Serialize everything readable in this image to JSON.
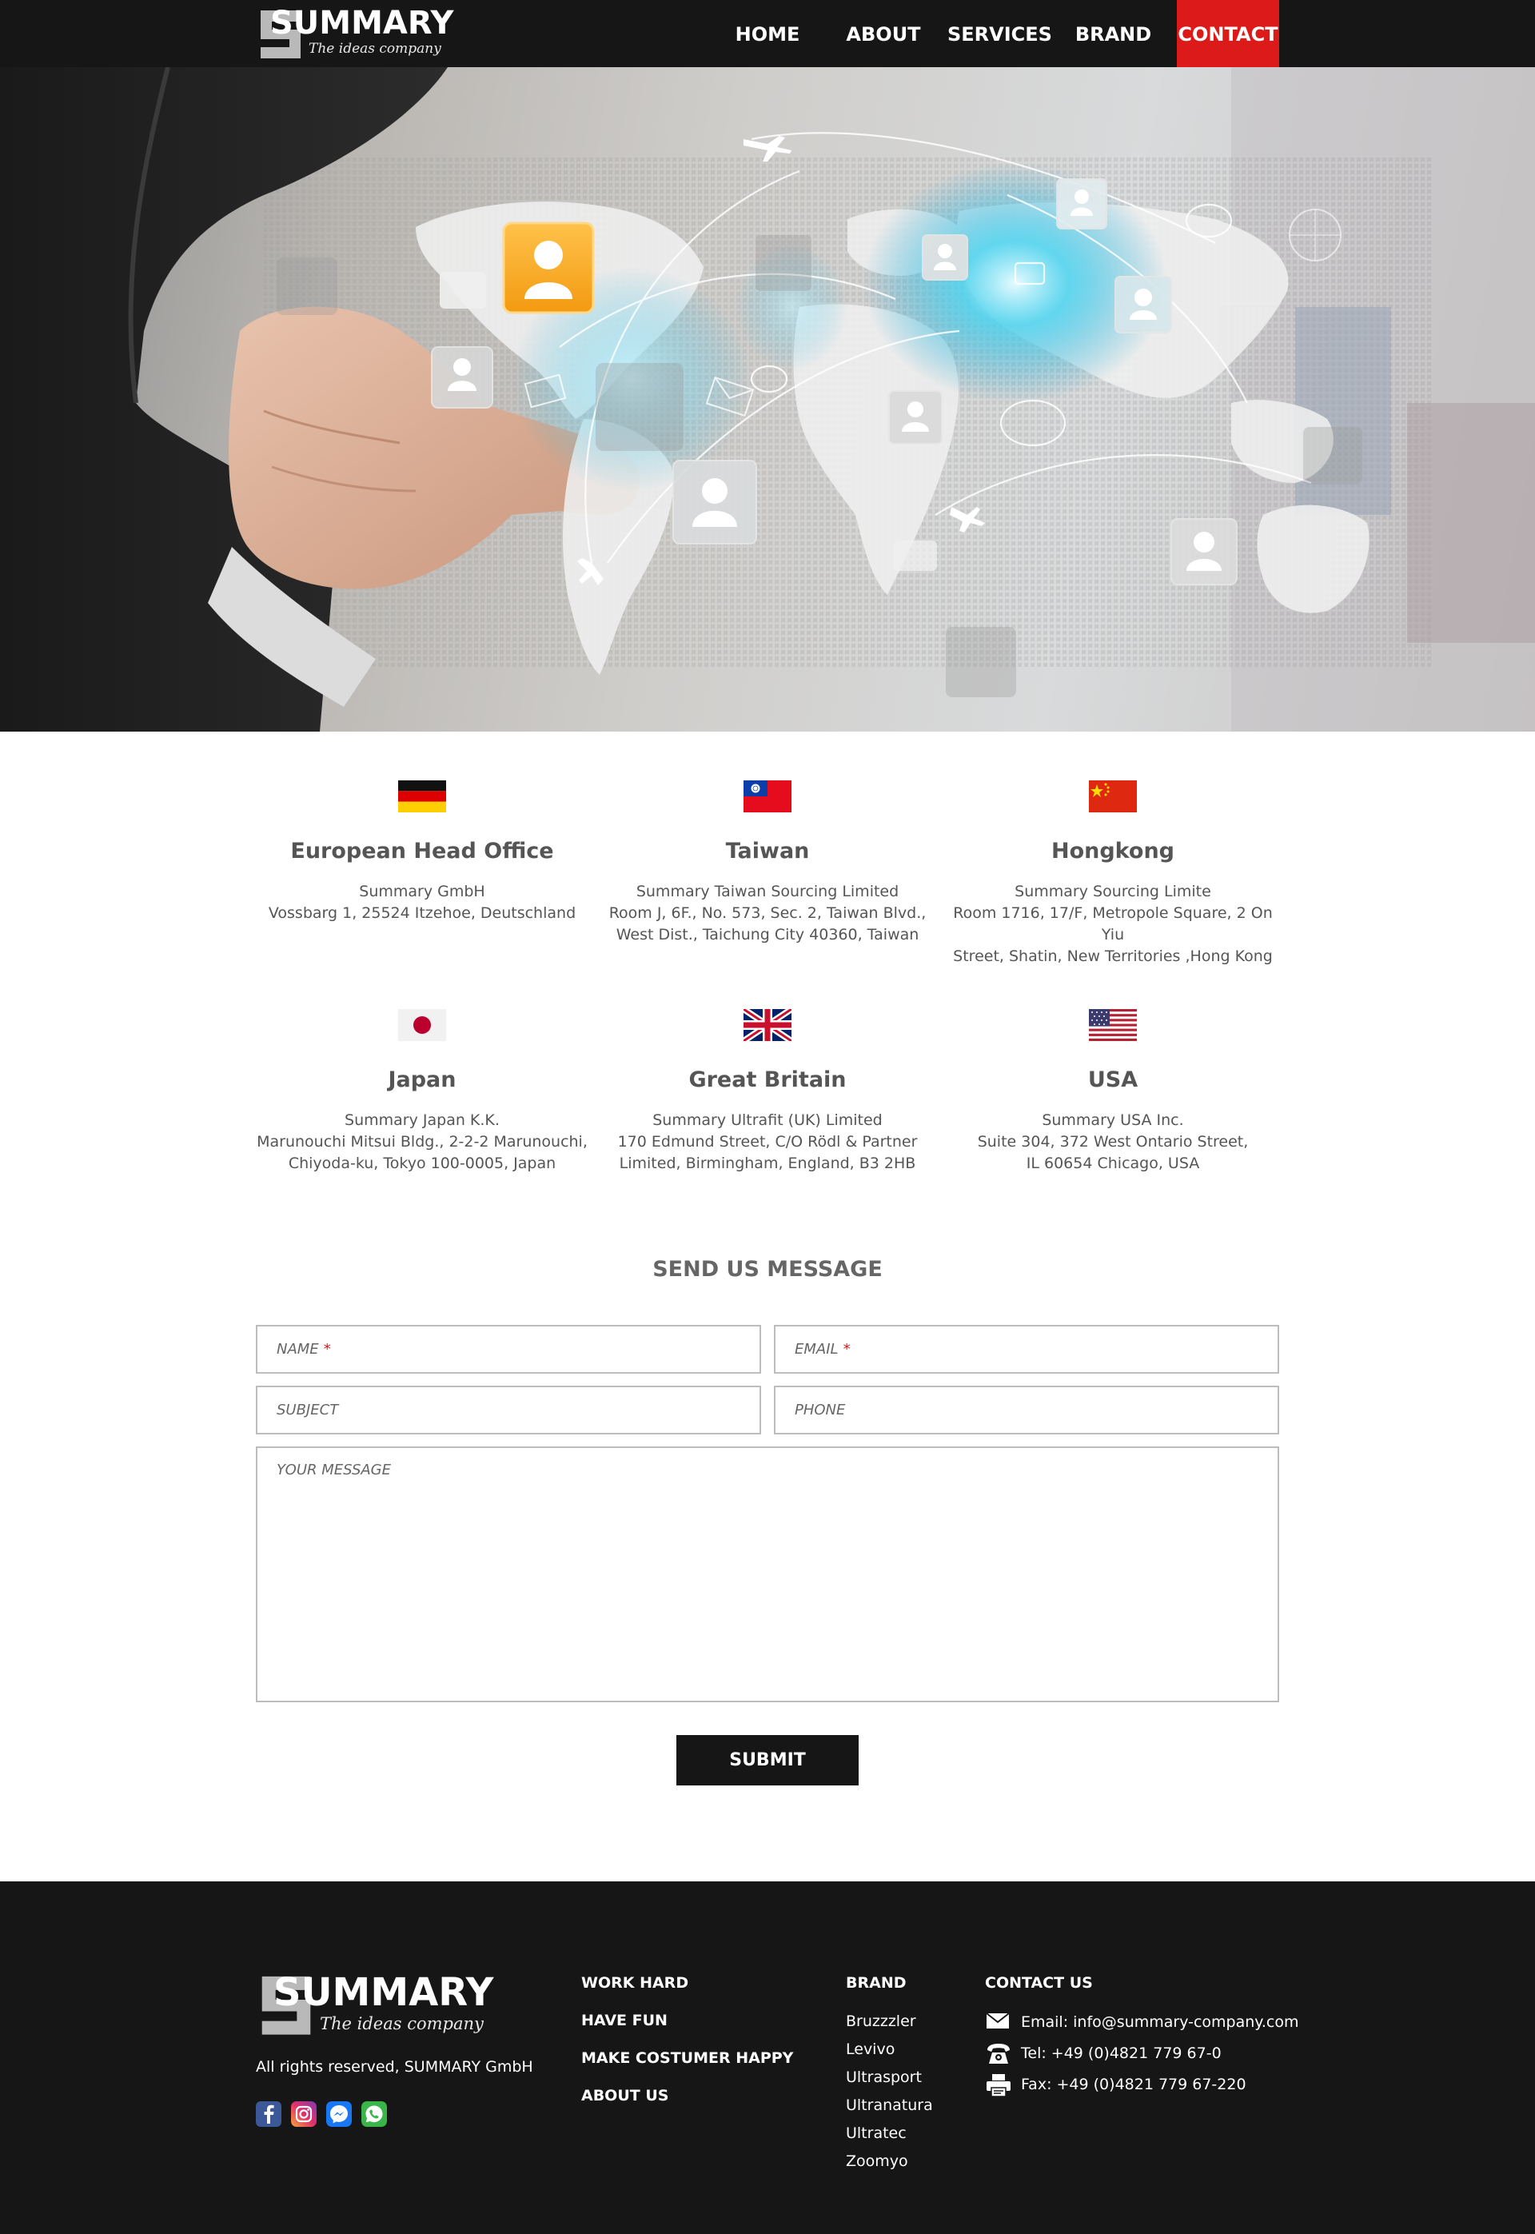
{
  "nav": {
    "logo": {
      "word": "SUMMARY",
      "tagline": "The ideas company"
    },
    "items": [
      "HOME",
      "ABOUT",
      "SERVICES",
      "BRAND",
      "CONTACT"
    ],
    "active": "CONTACT"
  },
  "offices": [
    {
      "country": "Germany",
      "title": "European Head Office",
      "lines": [
        "Summary GmbH",
        "Vossbarg 1, 25524 Itzehoe, Deutschland"
      ]
    },
    {
      "country": "Taiwan",
      "title": "Taiwan",
      "lines": [
        "Summary Taiwan Sourcing Limited",
        "Room J, 6F., No. 573, Sec. 2, Taiwan Blvd.,",
        "West Dist., Taichung City 40360, Taiwan"
      ]
    },
    {
      "country": "China",
      "title": "Hongkong",
      "lines": [
        "Summary Sourcing Limite",
        "Room 1716, 17/F, Metropole Square, 2 On Yiu",
        "Street, Shatin, New Territories ,Hong Kong"
      ]
    },
    {
      "country": "Japan",
      "title": "Japan",
      "lines": [
        "Summary Japan K.K.",
        "Marunouchi Mitsui Bldg., 2-2-2 Marunouchi,",
        "Chiyoda-ku, Tokyo 100-0005, Japan"
      ]
    },
    {
      "country": "United Kingdom",
      "title": "Great Britain",
      "lines": [
        "Summary Ultrafit (UK) Limited",
        "170 Edmund Street, C/O Rödl & Partner",
        "Limited, Birmingham, England, B3 2HB"
      ]
    },
    {
      "country": "United States",
      "title": "USA",
      "lines": [
        "Summary USA Inc.",
        "Suite 304, 372 West Ontario Street,",
        "IL 60654 Chicago, USA"
      ]
    }
  ],
  "form": {
    "title": "SEND US MESSAGE",
    "name_placeholder": "NAME",
    "email_placeholder": "EMAIL",
    "subject_placeholder": "SUBJECT",
    "phone_placeholder": "PHONE",
    "message_placeholder": "YOUR MESSAGE",
    "required_mark": "*",
    "submit_label": "SUBMIT"
  },
  "footer": {
    "logo": {
      "word": "SUMMARY",
      "tagline": "The ideas company"
    },
    "rights": "All rights reserved, SUMMARY GmbH",
    "social_icons": [
      "facebook-icon",
      "instagram-icon",
      "messenger-icon",
      "whatsapp-icon"
    ],
    "links": [
      "WORK HARD",
      "HAVE FUN",
      "MAKE COSTUMER HAPPY",
      "ABOUT US"
    ],
    "brand_title": "BRAND",
    "brands": [
      "Bruzzzler",
      "Levivo",
      "Ultrasport",
      "Ultranatura",
      "Ultratec",
      "Zoomyo"
    ],
    "contact_title": "CONTACT US",
    "email": "Email: info@summary-company.com",
    "tel": "Tel:  +49 (0)4821 779 67-0",
    "fax": "Fax: +49 (0)4821 779 67-220"
  },
  "colors": {
    "nav_bg": "#161616",
    "accent": "#dd1a1a",
    "footer_bg": "#161616",
    "text": "#555555"
  }
}
